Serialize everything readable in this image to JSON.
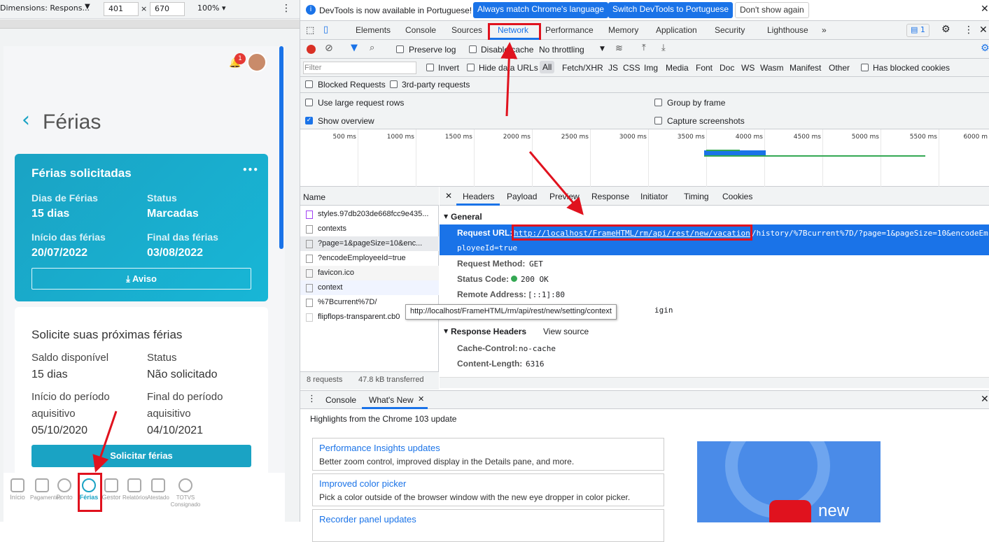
{
  "device_toolbar": {
    "device": "Dimensions: Respons...",
    "width": "401",
    "x": "×",
    "height": "670",
    "zoom": "100% ▾",
    "more": "⋮"
  },
  "app": {
    "notification_count": "1",
    "back": "‹",
    "page_title": "Férias",
    "card_requested": {
      "title": "Férias solicitadas",
      "menu": "•••",
      "days_label": "Dias de Férias",
      "days_value": "15 dias",
      "status_label": "Status",
      "status_value": "Marcadas",
      "start_label": "Início das férias",
      "start_value": "20/07/2022",
      "end_label": "Final das férias",
      "end_value": "03/08/2022",
      "notice_button": "⤓ Aviso"
    },
    "card_next": {
      "title": "Solicite suas próximas férias",
      "balance_label": "Saldo disponível",
      "balance_value": "15 dias",
      "status_label": "Status",
      "status_value": "Não solicitado",
      "period_start_label_1": "Início do período",
      "period_start_label_2": "aquisitivo",
      "period_start_value": "05/10/2020",
      "period_end_label_1": "Final do período",
      "period_end_label_2": "aquisitivo",
      "period_end_value": "04/10/2021",
      "request_button": "Solicitar férias"
    },
    "bottom_nav": [
      "Início",
      "Pagamentos",
      "Ponto",
      "Férias",
      "Gestor",
      "Relatórios",
      "Atestado",
      "TOTVS Consignado"
    ]
  },
  "devtools": {
    "infobar": {
      "text": "DevTools is now available in Portuguese!",
      "btn1": "Always match Chrome's language",
      "btn2": "Switch DevTools to Portuguese",
      "btn3": "Don't show again"
    },
    "tabs": [
      "Elements",
      "Console",
      "Sources",
      "Network",
      "Performance",
      "Memory",
      "Application",
      "Security",
      "Lighthouse",
      "»"
    ],
    "issues_badge": "1",
    "controls": {
      "preserve_log": "Preserve log",
      "disable_cache": "Disable cache",
      "throttling": "No throttling"
    },
    "filter": {
      "placeholder": "Filter",
      "invert": "Invert",
      "hide_data_urls": "Hide data URLs",
      "types": [
        "All",
        "Fetch/XHR",
        "JS",
        "CSS",
        "Img",
        "Media",
        "Font",
        "Doc",
        "WS",
        "Wasm",
        "Manifest",
        "Other"
      ],
      "blocked_cookies": "Has blocked cookies",
      "blocked_requests": "Blocked Requests",
      "third_party": "3rd-party requests"
    },
    "options": {
      "large_rows": "Use large request rows",
      "group_by_frame": "Group by frame",
      "show_overview": "Show overview",
      "capture_screenshots": "Capture screenshots"
    },
    "timeline_ticks": [
      "500 ms",
      "1000 ms",
      "1500 ms",
      "2000 ms",
      "2500 ms",
      "3000 ms",
      "3500 ms",
      "4000 ms",
      "4500 ms",
      "5000 ms",
      "5500 ms",
      "6000 m"
    ],
    "requests_header": "Name",
    "requests": [
      "styles.97db203de668fcc9e435...",
      "contexts",
      "?page=1&pageSize=10&enc...",
      "?encodeEmployeeId=true",
      "favicon.ico",
      "context",
      "%7Bcurrent%7D/",
      "flipflops-transparent.cb0"
    ],
    "summary": {
      "requests": "8 requests",
      "transferred": "47.8 kB transferred"
    },
    "detail_tabs": [
      "Headers",
      "Payload",
      "Preview",
      "Response",
      "Initiator",
      "Timing",
      "Cookies"
    ],
    "general": {
      "title": "General",
      "url_label": "Request URL:",
      "url_value_1": "http://localhost/FrameHTML/rm/api/rest/new/vacation",
      "url_value_2": "/history/%7Bcurrent%7D/?page=1&pageSize=10&encodeEm",
      "url_value_3": "ployeeId=true",
      "method_label": "Request Method:",
      "method_value": "GET",
      "status_label": "Status Code:",
      "status_value": "200 OK",
      "remote_label": "Remote Address:",
      "remote_value": "[::1]:80",
      "referrer_tail": "igin"
    },
    "tooltip": "http://localhost/FrameHTML/rm/api/rest/new/setting/context",
    "response_headers": {
      "title": "Response Headers",
      "view_source": "View source",
      "cache_label": "Cache-Control:",
      "cache_value": "no-cache",
      "length_label": "Content-Length:",
      "length_value": "6316"
    },
    "drawer": {
      "tabs": [
        "Console",
        "What's New"
      ],
      "highlights": "Highlights from the Chrome 103 update",
      "items": [
        {
          "title": "Performance Insights updates",
          "desc": "Better zoom control, improved display in the Details pane, and more."
        },
        {
          "title": "Improved color picker",
          "desc": "Pick a color outside of the browser window with the new eye dropper in color picker."
        },
        {
          "title": "Recorder panel updates",
          "desc": ""
        }
      ],
      "video_label": "new"
    }
  },
  "colors": {
    "accent": "#1a73e8",
    "teal": "#1aa3c4",
    "annotation": "#e0121e"
  }
}
